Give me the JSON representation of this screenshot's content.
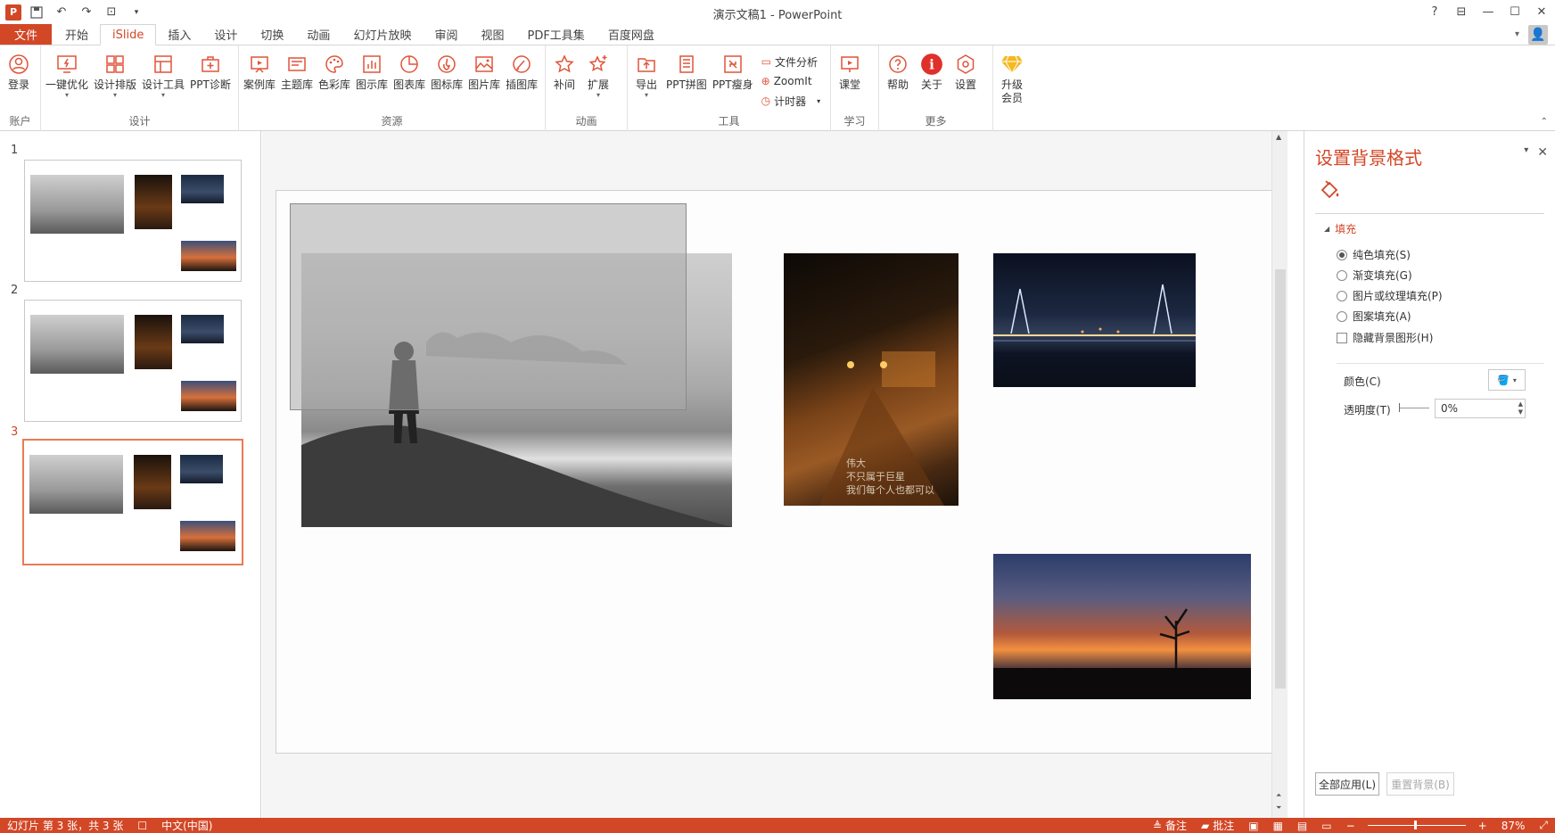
{
  "window": {
    "title": "演示文稿1 - PowerPoint"
  },
  "qat": {
    "app_icon": "P"
  },
  "tabs": [
    {
      "label": "文件"
    },
    {
      "label": "开始"
    },
    {
      "label": "iSlide"
    },
    {
      "label": "插入"
    },
    {
      "label": "设计"
    },
    {
      "label": "切换"
    },
    {
      "label": "动画"
    },
    {
      "label": "幻灯片放映"
    },
    {
      "label": "审阅"
    },
    {
      "label": "视图"
    },
    {
      "label": "PDF工具集"
    },
    {
      "label": "百度网盘"
    }
  ],
  "ribbon": {
    "groups": {
      "account": "账户",
      "design": "设计",
      "resources": "资源",
      "animation": "动画",
      "tools": "工具",
      "learn": "学习",
      "more": "更多"
    },
    "buttons": {
      "login": "登录",
      "one_click": "一键优化",
      "layout": "设计排版",
      "design_tools": "设计工具",
      "ppt_diag": "PPT诊断",
      "cases": "案例库",
      "themes": "主题库",
      "colors": "色彩库",
      "icons_lib": "图示库",
      "charts": "图表库",
      "iconlib": "图标库",
      "pictures": "图片库",
      "illus": "插图库",
      "tween": "补间",
      "extend": "扩展",
      "export": "导出",
      "ppt_puzzle": "PPT拼图",
      "ppt_slim": "PPT瘦身",
      "file_analysis": "文件分析",
      "zoomit": "ZoomIt",
      "timer": "计时器",
      "class": "课堂",
      "help": "帮助",
      "about": "关于",
      "settings": "设置",
      "upgrade_l1": "升级",
      "upgrade_l2": "会员"
    }
  },
  "slides": [
    {
      "num": "1"
    },
    {
      "num": "2"
    },
    {
      "num": "3"
    }
  ],
  "slide_text": {
    "line1": "伟大",
    "line2": "不只属于巨星",
    "line3": "我们每个人也都可以"
  },
  "format_pane": {
    "title": "设置背景格式",
    "section": "填充",
    "options": {
      "solid": "纯色填充(S)",
      "gradient": "渐变填充(G)",
      "picture": "图片或纹理填充(P)",
      "pattern": "图案填充(A)",
      "hide": "隐藏背景图形(H)"
    },
    "color_label": "颜色(C)",
    "transparency_label": "透明度(T)",
    "transparency_value": "0%",
    "apply_all": "全部应用(L)",
    "reset": "重置背景(B)"
  },
  "status": {
    "slide_info": "幻灯片 第 3 张，共 3 张",
    "language": "中文(中国)",
    "notes": "备注",
    "comments": "批注",
    "zoom": "87%"
  },
  "colors": {
    "accent": "#d24726"
  }
}
